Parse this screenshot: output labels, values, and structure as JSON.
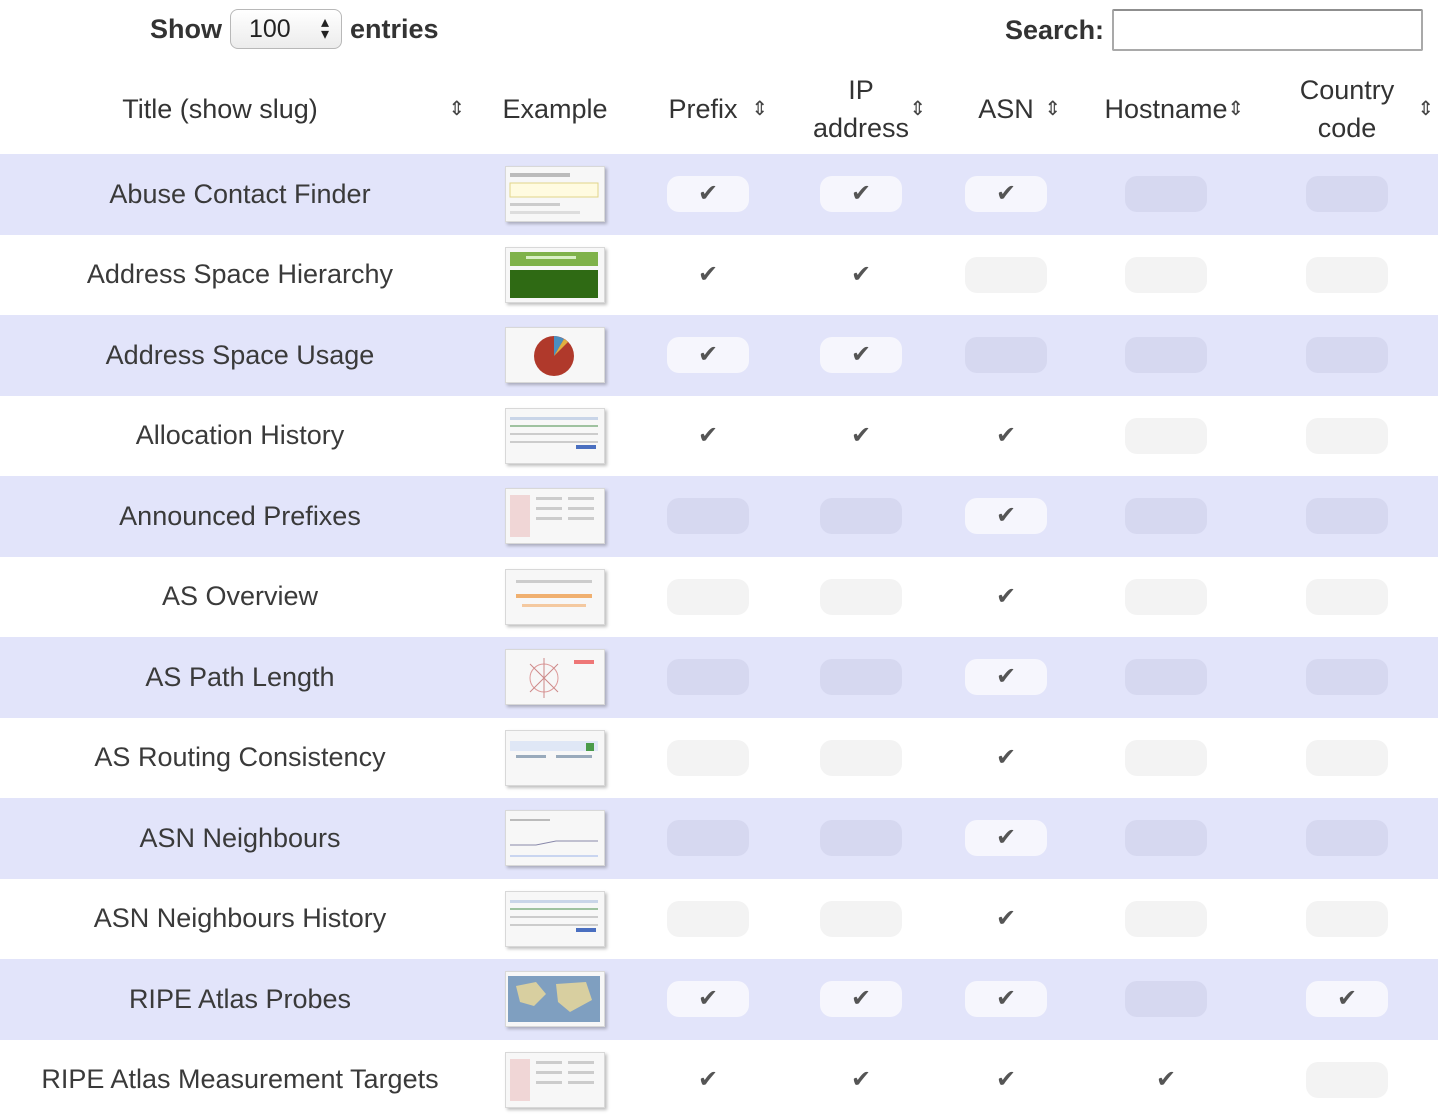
{
  "controls": {
    "show_label": "Show",
    "entries_label": "entries",
    "page_size": "100",
    "search_label": "Search:",
    "search_value": ""
  },
  "columns": [
    "Title (show slug)",
    "Example",
    "Prefix",
    "IP address",
    "ASN",
    "Hostname",
    "Country code"
  ],
  "check_glyph": "✔",
  "rows": [
    {
      "title": "Abuse Contact Finder",
      "thumb": "form",
      "flags": [
        true,
        true,
        true,
        false,
        false
      ]
    },
    {
      "title": "Address Space Hierarchy",
      "thumb": "green",
      "flags": [
        true,
        true,
        false,
        false,
        false
      ]
    },
    {
      "title": "Address Space Usage",
      "thumb": "pie",
      "flags": [
        true,
        true,
        false,
        false,
        false
      ]
    },
    {
      "title": "Allocation History",
      "thumb": "timeline",
      "flags": [
        true,
        true,
        true,
        false,
        false
      ]
    },
    {
      "title": "Announced Prefixes",
      "thumb": "table",
      "flags": [
        false,
        false,
        true,
        false,
        false
      ]
    },
    {
      "title": "AS Overview",
      "thumb": "orange",
      "flags": [
        false,
        false,
        true,
        false,
        false
      ]
    },
    {
      "title": "AS Path Length",
      "thumb": "radial",
      "flags": [
        false,
        false,
        true,
        false,
        false
      ]
    },
    {
      "title": "AS Routing Consistency",
      "thumb": "blue-table",
      "flags": [
        false,
        false,
        true,
        false,
        false
      ]
    },
    {
      "title": "ASN Neighbours",
      "thumb": "lines",
      "flags": [
        false,
        false,
        true,
        false,
        false
      ]
    },
    {
      "title": "ASN Neighbours History",
      "thumb": "timeline",
      "flags": [
        false,
        false,
        true,
        false,
        false
      ]
    },
    {
      "title": "RIPE Atlas Probes",
      "thumb": "map",
      "flags": [
        true,
        true,
        true,
        false,
        true
      ]
    },
    {
      "title": "RIPE Atlas Measurement Targets",
      "thumb": "table",
      "flags": [
        true,
        true,
        true,
        true,
        false
      ]
    }
  ]
}
